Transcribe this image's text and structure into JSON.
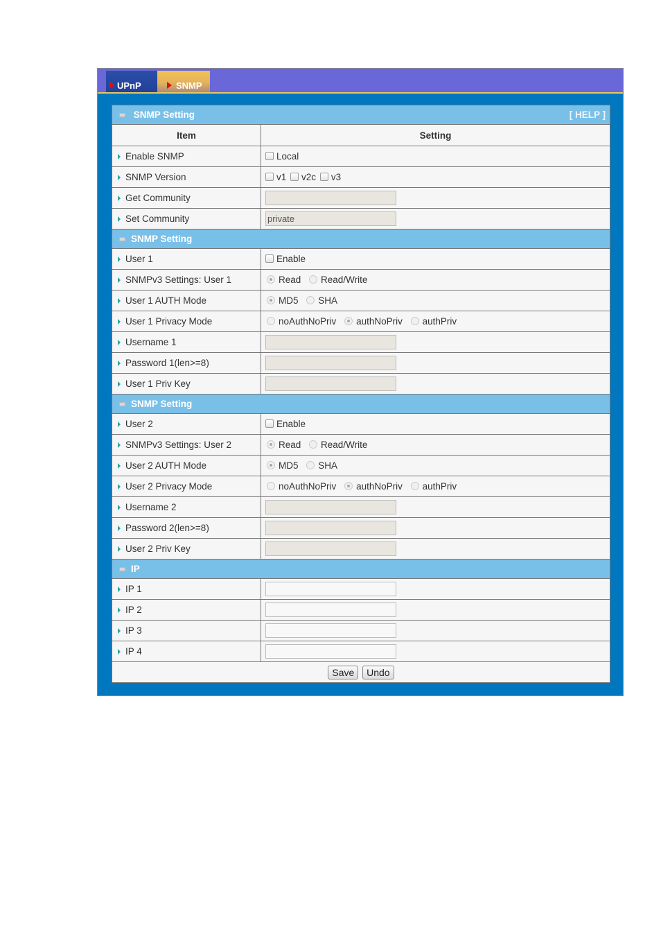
{
  "tabs": [
    {
      "label": "UPnP",
      "active": false
    },
    {
      "label": "SNMP",
      "active": true
    }
  ],
  "colors": {
    "tabbar": "#6a67d8",
    "active_tab": "#f2c252",
    "frame": "#0077be",
    "section_header": "#79c0e8"
  },
  "help_label": "[ HELP ]",
  "columns": {
    "item": "Item",
    "setting": "Setting"
  },
  "sections": {
    "general": {
      "title": "SNMP Setting",
      "enable_snmp": {
        "label": "Enable SNMP",
        "option": "Local",
        "checked": false
      },
      "snmp_version": {
        "label": "SNMP Version",
        "options": [
          {
            "label": "v1",
            "checked": false
          },
          {
            "label": "v2c",
            "checked": false
          },
          {
            "label": "v3",
            "checked": false
          }
        ]
      },
      "get_community": {
        "label": "Get Community",
        "value": ""
      },
      "set_community": {
        "label": "Set Community",
        "value": "private"
      }
    },
    "user1": {
      "title": "SNMP Setting",
      "user": {
        "label": "User 1",
        "option": "Enable",
        "checked": false
      },
      "access": {
        "label": "SNMPv3 Settings: User 1",
        "options": [
          "Read",
          "Read/Write"
        ],
        "selected": "Read"
      },
      "auth": {
        "label": "User 1 AUTH Mode",
        "options": [
          "MD5",
          "SHA"
        ],
        "selected": "MD5"
      },
      "privacy": {
        "label": "User 1 Privacy Mode",
        "options": [
          "noAuthNoPriv",
          "authNoPriv",
          "authPriv"
        ],
        "selected": "authNoPriv"
      },
      "username": {
        "label": "Username 1",
        "value": ""
      },
      "password": {
        "label": "Password 1(len>=8)",
        "value": ""
      },
      "privkey": {
        "label": "User 1 Priv Key",
        "value": ""
      }
    },
    "user2": {
      "title": "SNMP Setting",
      "user": {
        "label": "User 2",
        "option": "Enable",
        "checked": false
      },
      "access": {
        "label": "SNMPv3 Settings: User 2",
        "options": [
          "Read",
          "Read/Write"
        ],
        "selected": "Read"
      },
      "auth": {
        "label": "User 2 AUTH Mode",
        "options": [
          "MD5",
          "SHA"
        ],
        "selected": "MD5"
      },
      "privacy": {
        "label": "User 2 Privacy Mode",
        "options": [
          "noAuthNoPriv",
          "authNoPriv",
          "authPriv"
        ],
        "selected": "authNoPriv"
      },
      "username": {
        "label": "Username 2",
        "value": ""
      },
      "password": {
        "label": "Password 2(len>=8)",
        "value": ""
      },
      "privkey": {
        "label": "User 2 Priv Key",
        "value": ""
      }
    },
    "ip": {
      "title": "IP",
      "rows": [
        {
          "label": "IP 1",
          "value": ""
        },
        {
          "label": "IP 2",
          "value": ""
        },
        {
          "label": "IP 3",
          "value": ""
        },
        {
          "label": "IP 4",
          "value": ""
        }
      ]
    }
  },
  "buttons": {
    "save": "Save",
    "undo": "Undo"
  }
}
